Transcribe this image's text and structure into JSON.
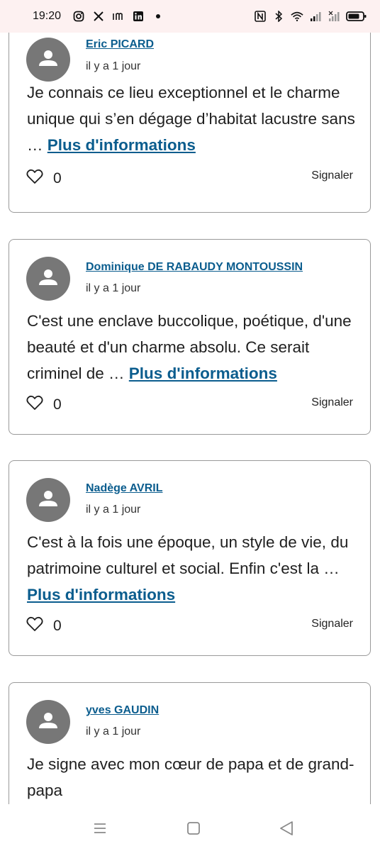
{
  "status_bar": {
    "time": "19:20",
    "notification_icons": [
      "instagram-icon",
      "x-icon",
      "news-icon",
      "linkedin-icon",
      "dot-icon"
    ],
    "system_icons": [
      "nfc-icon",
      "bluetooth-icon",
      "wifi-icon",
      "signal-icon",
      "signal-off-icon",
      "battery-icon"
    ]
  },
  "comments": [
    {
      "author": "Eric PICARD",
      "date": "il y a 1 jour",
      "text": "Je connais ce lieu exceptionnel et le charme unique qui s’en dégage d’habitat lacustre sans … ",
      "more_label": "Plus d'informations",
      "likes": "0",
      "report_label": "Signaler"
    },
    {
      "author": "Dominique DE RABAUDY MONTOUSSIN",
      "date": "il y a 1 jour",
      "text": "C'est une enclave buccolique, poétique, d'une beauté et d'un charme absolu. Ce serait criminel de … ",
      "more_label": "Plus d'informations",
      "likes": "0",
      "report_label": "Signaler"
    },
    {
      "author": "Nadège AVRIL",
      "date": "il y a 1 jour",
      "text": "C'est à la fois une époque, un style de vie, du patrimoine culturel et social. Enfin c'est la … ",
      "more_label": "Plus d'informations",
      "likes": "0",
      "report_label": "Signaler"
    },
    {
      "author": "yves GAUDIN",
      "date": "il y a 1 jour",
      "text": "Je signe avec mon cœur de papa et de grand-papa"
    }
  ],
  "nav_bar": {
    "buttons": [
      "recents-icon",
      "home-icon",
      "back-icon"
    ]
  },
  "colors": {
    "link": "#0b5d8e",
    "avatar": "#777777",
    "card_border": "#9a9a9a",
    "status_bar_bg": "#fdf1f1"
  }
}
